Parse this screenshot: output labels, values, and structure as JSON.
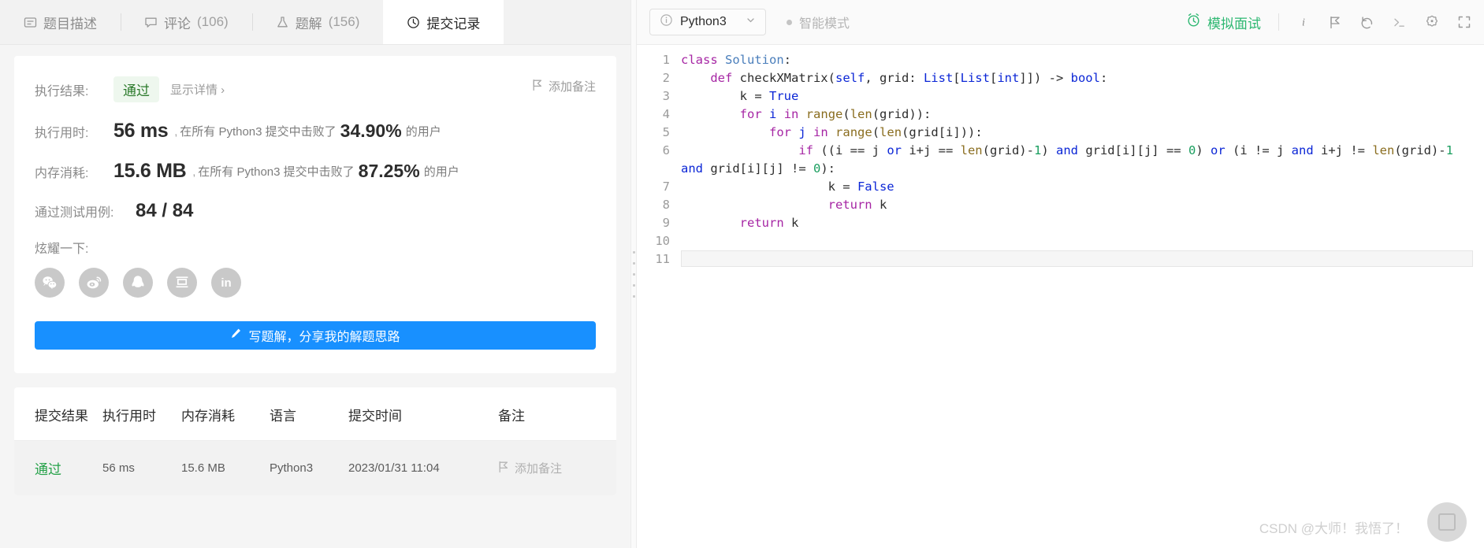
{
  "tabs": [
    {
      "label": "题目描述",
      "icon": "description-icon",
      "count": "",
      "active": false
    },
    {
      "label": "评论",
      "icon": "comment-icon",
      "count": "(106)",
      "active": false
    },
    {
      "label": "题解",
      "icon": "flask-icon",
      "count": "(156)",
      "active": false
    },
    {
      "label": "提交记录",
      "icon": "clock-icon",
      "count": "",
      "active": true
    }
  ],
  "result": {
    "exec_result_label": "执行结果:",
    "status": "通过",
    "show_detail": "显示详情 ›",
    "add_note": "添加备注",
    "runtime_label": "执行用时:",
    "runtime_value": "56 ms",
    "runtime_comma": ",",
    "runtime_mid": "在所有 Python3 提交中击败了",
    "runtime_pct": "34.90%",
    "runtime_suffix": "的用户",
    "memory_label": "内存消耗:",
    "memory_value": "15.6 MB",
    "memory_comma": ",",
    "memory_mid": "在所有 Python3 提交中击败了",
    "memory_pct": "87.25%",
    "memory_suffix": "的用户",
    "testcase_label": "通过测试用例:",
    "testcase_value": "84 / 84",
    "share_label": "炫耀一下:",
    "share_icons": [
      {
        "name": "wechat-icon"
      },
      {
        "name": "weibo-icon"
      },
      {
        "name": "qq-icon"
      },
      {
        "name": "douban-icon"
      },
      {
        "name": "linkedin-icon",
        "text": "in"
      }
    ],
    "cta_label": "写题解，分享我的解题思路",
    "cta_icon": "pencil-icon",
    "cta_color": "#1890ff"
  },
  "submissions": {
    "headers": [
      "提交结果",
      "执行用时",
      "内存消耗",
      "语言",
      "提交时间",
      "备注"
    ],
    "rows": [
      {
        "result": "通过",
        "runtime": "56 ms",
        "memory": "15.6 MB",
        "language": "Python3",
        "timestamp": "2023/01/31 11:04",
        "note": "添加备注"
      }
    ]
  },
  "editor": {
    "language": "Python3",
    "language_icon": "info-circle-icon",
    "caret_icon": "chevron-down-icon",
    "smart_mode": "智能模式",
    "mock_interview": "模拟面试",
    "mock_icon": "alarm-clock-icon",
    "mock_color": "#2eb872",
    "toolbar_icons": [
      {
        "name": "info-icon"
      },
      {
        "name": "flag-icon"
      },
      {
        "name": "undo-icon"
      },
      {
        "name": "console-icon"
      },
      {
        "name": "gear-icon"
      },
      {
        "name": "fullscreen-icon"
      }
    ],
    "line_numbers": [
      "1",
      "2",
      "3",
      "4",
      "5",
      "6",
      "7",
      "8",
      "9",
      "10",
      "11"
    ],
    "code_lines": [
      "class Solution:",
      "    def checkXMatrix(self, grid: List[List[int]]) -> bool:",
      "        k = True",
      "        for i in range(len(grid)):",
      "            for j in range(len(grid[i])):",
      "                if ((i == j or i+j == len(grid)-1) and grid[i][j] == 0) or (i != j and i+j != len(grid)-1 and grid[i][j] != 0):",
      "                    k = False",
      "                    return k",
      "        return k",
      "",
      ""
    ]
  },
  "watermark": {
    "text": "CSDN @大师！我悟了！",
    "fab_icon": "expand-icon"
  }
}
